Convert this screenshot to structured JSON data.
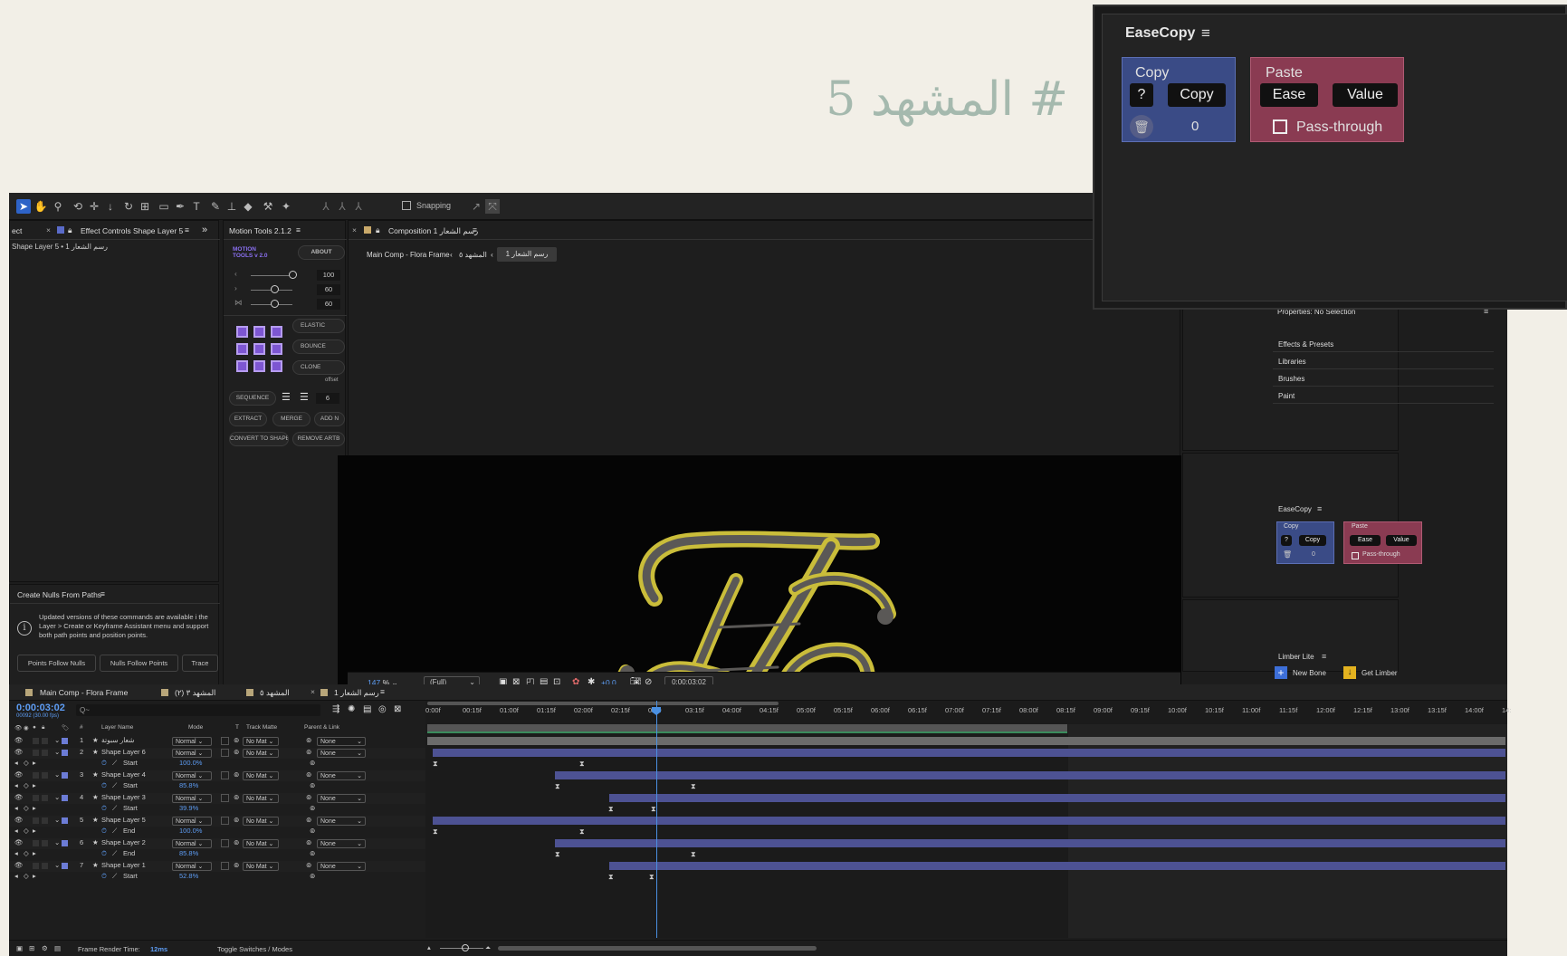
{
  "heading": "# المشهد 5",
  "toolbar": {
    "snapping_label": "Snapping"
  },
  "left_panel": {
    "tab_ect": "ect",
    "tab_effect_controls": "Effect Controls Shape Layer 5",
    "subtitle": "Shape Layer 5 • 1 رسم الشعار"
  },
  "motion_tools": {
    "tab": "Motion Tools 2.1.2",
    "logo_line1": "MOTION",
    "logo_line2": "TOOLS v 2.0",
    "about": "ABOUT",
    "val1": "100",
    "val2": "60",
    "val3": "60",
    "elastic": "ELASTIC",
    "bounce": "BOUNCE",
    "clone": "CLONE",
    "offset": "offset",
    "sequence": "SEQUENCE",
    "seq_val": "6",
    "extract": "EXTRACT",
    "merge": "MERGE",
    "add": "ADD N",
    "convert": "CONVERT TO SHAPE",
    "remove": "REMOVE ARTB"
  },
  "nulls_panel": {
    "title": "Create Nulls From Paths",
    "info": "Updated versions of these commands are available i the Layer > Create or Keyframe Assistant menu and support both path points and position points.",
    "btn1": "Points Follow Nulls",
    "btn2": "Nulls Follow Points",
    "btn3": "Trace"
  },
  "composition": {
    "tab": "Composition 1 رسم الشعار",
    "crumb1": "Main Comp - Flora Frame",
    "crumb2": "المشهد ٥",
    "crumb3": "1 رسم الشعار",
    "zoom": "147",
    "zoom_unit": "%",
    "resolution": "(Full)",
    "exposure": "+0.0",
    "timecode": "0:00:03:02"
  },
  "easecopy_large": {
    "title": "EaseCopy",
    "copy_title": "Copy",
    "paste_title": "Paste",
    "help": "?",
    "copy_btn": "Copy",
    "ease_btn": "Ease",
    "value_btn": "Value",
    "count": "0",
    "passthrough": "Pass-through"
  },
  "right_panel": {
    "properties": "Properties: No Selection",
    "items": [
      "Effects & Presets",
      "Libraries",
      "Brushes",
      "Paint"
    ],
    "easecopy_title": "EaseCopy",
    "limber_title": "Limber Lite",
    "new_bone": "New Bone",
    "get_limber": "Get Limber"
  },
  "timeline": {
    "tabs": [
      "Main Comp - Flora Frame",
      "المشهد ٣ (٢)",
      "المشهد ٥",
      "1 رسم الشعار"
    ],
    "timecode": "0:00:03:02",
    "fps": "00092 (30.00 fps)",
    "search_placeholder": "Q~",
    "col_num": "#",
    "col_layer": "Layer Name",
    "col_mode": "Mode",
    "col_t": "T",
    "col_track": "Track Matte",
    "col_parent": "Parent & Link",
    "ruler": [
      "0:00f",
      "00:15f",
      "01:00f",
      "01:15f",
      "02:00f",
      "02:15f",
      "03:0",
      "03:15f",
      "04:00f",
      "04:15f",
      "05:00f",
      "05:15f",
      "06:00f",
      "06:15f",
      "07:00f",
      "07:15f",
      "08:00f",
      "08:15f",
      "09:00f",
      "09:15f",
      "10:00f",
      "10:15f",
      "11:00f",
      "11:15f",
      "12:00f",
      "12:15f",
      "13:00f",
      "13:15f",
      "14:00f",
      "14:"
    ],
    "layers": [
      {
        "num": "1",
        "name": "شعار سبوتة",
        "mode": "Normal",
        "matte": "No Mat",
        "parent": "None",
        "type": "layer"
      },
      {
        "num": "2",
        "name": "Shape Layer 6",
        "mode": "Normal",
        "matte": "No Mat",
        "parent": "None",
        "type": "layer"
      },
      {
        "num": "",
        "name": "Start",
        "value": "100.0%",
        "type": "prop"
      },
      {
        "num": "3",
        "name": "Shape Layer 4",
        "mode": "Normal",
        "matte": "No Mat",
        "parent": "None",
        "type": "layer"
      },
      {
        "num": "",
        "name": "Start",
        "value": "85.8%",
        "type": "prop"
      },
      {
        "num": "4",
        "name": "Shape Layer 3",
        "mode": "Normal",
        "matte": "No Mat",
        "parent": "None",
        "type": "layer"
      },
      {
        "num": "",
        "name": "Start",
        "value": "39.9%",
        "type": "prop"
      },
      {
        "num": "5",
        "name": "Shape Layer 5",
        "mode": "Normal",
        "matte": "No Mat",
        "parent": "None",
        "type": "layer"
      },
      {
        "num": "",
        "name": "End",
        "value": "100.0%",
        "type": "prop"
      },
      {
        "num": "6",
        "name": "Shape Layer 2",
        "mode": "Normal",
        "matte": "No Mat",
        "parent": "None",
        "type": "layer"
      },
      {
        "num": "",
        "name": "End",
        "value": "85.8%",
        "type": "prop"
      },
      {
        "num": "7",
        "name": "Shape Layer 1",
        "mode": "Normal",
        "matte": "No Mat",
        "parent": "None",
        "type": "layer"
      },
      {
        "num": "",
        "name": "Start",
        "value": "52.8%",
        "type": "prop"
      }
    ],
    "render_label": "Frame Render Time:",
    "render_value": "12ms",
    "toggle_label": "Toggle Switches / Modes"
  }
}
